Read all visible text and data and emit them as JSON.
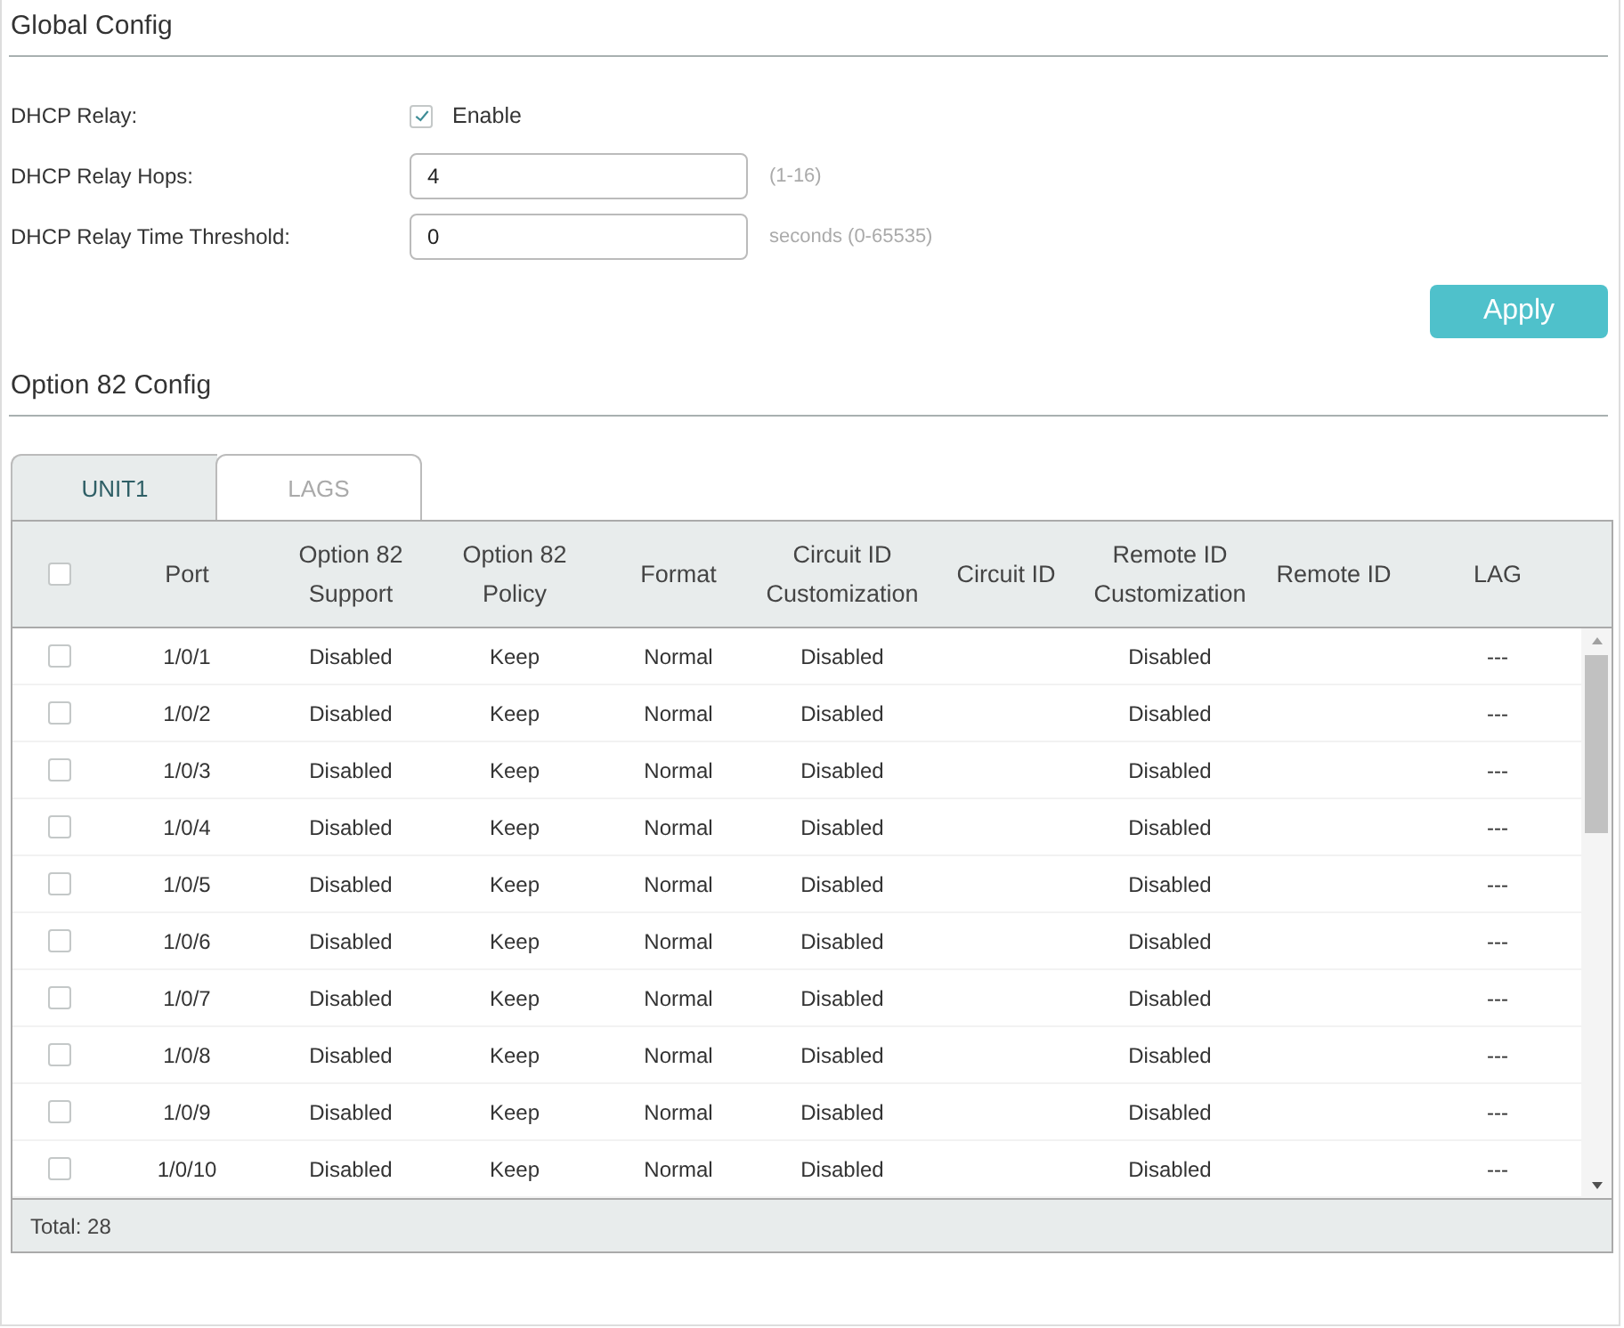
{
  "global_config": {
    "title": "Global Config",
    "fields": [
      {
        "kind": "checkbox",
        "label": "DHCP Relay:",
        "option": "Enable",
        "checked": true
      },
      {
        "kind": "input",
        "label": "DHCP Relay Hops:",
        "value": "4",
        "hint": "(1-16)"
      },
      {
        "kind": "input",
        "label": "DHCP Relay Time Threshold:",
        "value": "0",
        "hint": "seconds (0-65535)"
      }
    ],
    "apply_button": "Apply"
  },
  "option82_config": {
    "title": "Option 82 Config",
    "tabs": [
      {
        "label": "UNIT1",
        "selected": true
      },
      {
        "label": "LAGS",
        "selected": false
      }
    ],
    "table": {
      "select_all_checked": false,
      "columns": [
        "Port",
        "Option 82 Support",
        "Option 82 Policy",
        "Format",
        "Circuit ID Customization",
        "Circuit ID",
        "Remote ID Customization",
        "Remote ID",
        "LAG"
      ],
      "rows": [
        {
          "checked": false,
          "cells": [
            "1/0/1",
            "Disabled",
            "Keep",
            "Normal",
            "Disabled",
            null,
            "Disabled",
            null,
            "---"
          ]
        },
        {
          "checked": false,
          "cells": [
            "1/0/2",
            "Disabled",
            "Keep",
            "Normal",
            "Disabled",
            null,
            "Disabled",
            null,
            "---"
          ]
        },
        {
          "checked": false,
          "cells": [
            "1/0/3",
            "Disabled",
            "Keep",
            "Normal",
            "Disabled",
            null,
            "Disabled",
            null,
            "---"
          ]
        },
        {
          "checked": false,
          "cells": [
            "1/0/4",
            "Disabled",
            "Keep",
            "Normal",
            "Disabled",
            null,
            "Disabled",
            null,
            "---"
          ]
        },
        {
          "checked": false,
          "cells": [
            "1/0/5",
            "Disabled",
            "Keep",
            "Normal",
            "Disabled",
            null,
            "Disabled",
            null,
            "---"
          ]
        },
        {
          "checked": false,
          "cells": [
            "1/0/6",
            "Disabled",
            "Keep",
            "Normal",
            "Disabled",
            null,
            "Disabled",
            null,
            "---"
          ]
        },
        {
          "checked": false,
          "cells": [
            "1/0/7",
            "Disabled",
            "Keep",
            "Normal",
            "Disabled",
            null,
            "Disabled",
            null,
            "---"
          ]
        },
        {
          "checked": false,
          "cells": [
            "1/0/8",
            "Disabled",
            "Keep",
            "Normal",
            "Disabled",
            null,
            "Disabled",
            null,
            "---"
          ]
        },
        {
          "checked": false,
          "cells": [
            "1/0/9",
            "Disabled",
            "Keep",
            "Normal",
            "Disabled",
            null,
            "Disabled",
            null,
            "---"
          ]
        },
        {
          "checked": false,
          "cells": [
            "1/0/10",
            "Disabled",
            "Keep",
            "Normal",
            "Disabled",
            null,
            "Disabled",
            null,
            "---"
          ]
        }
      ],
      "footer": "Total: 28"
    }
  }
}
